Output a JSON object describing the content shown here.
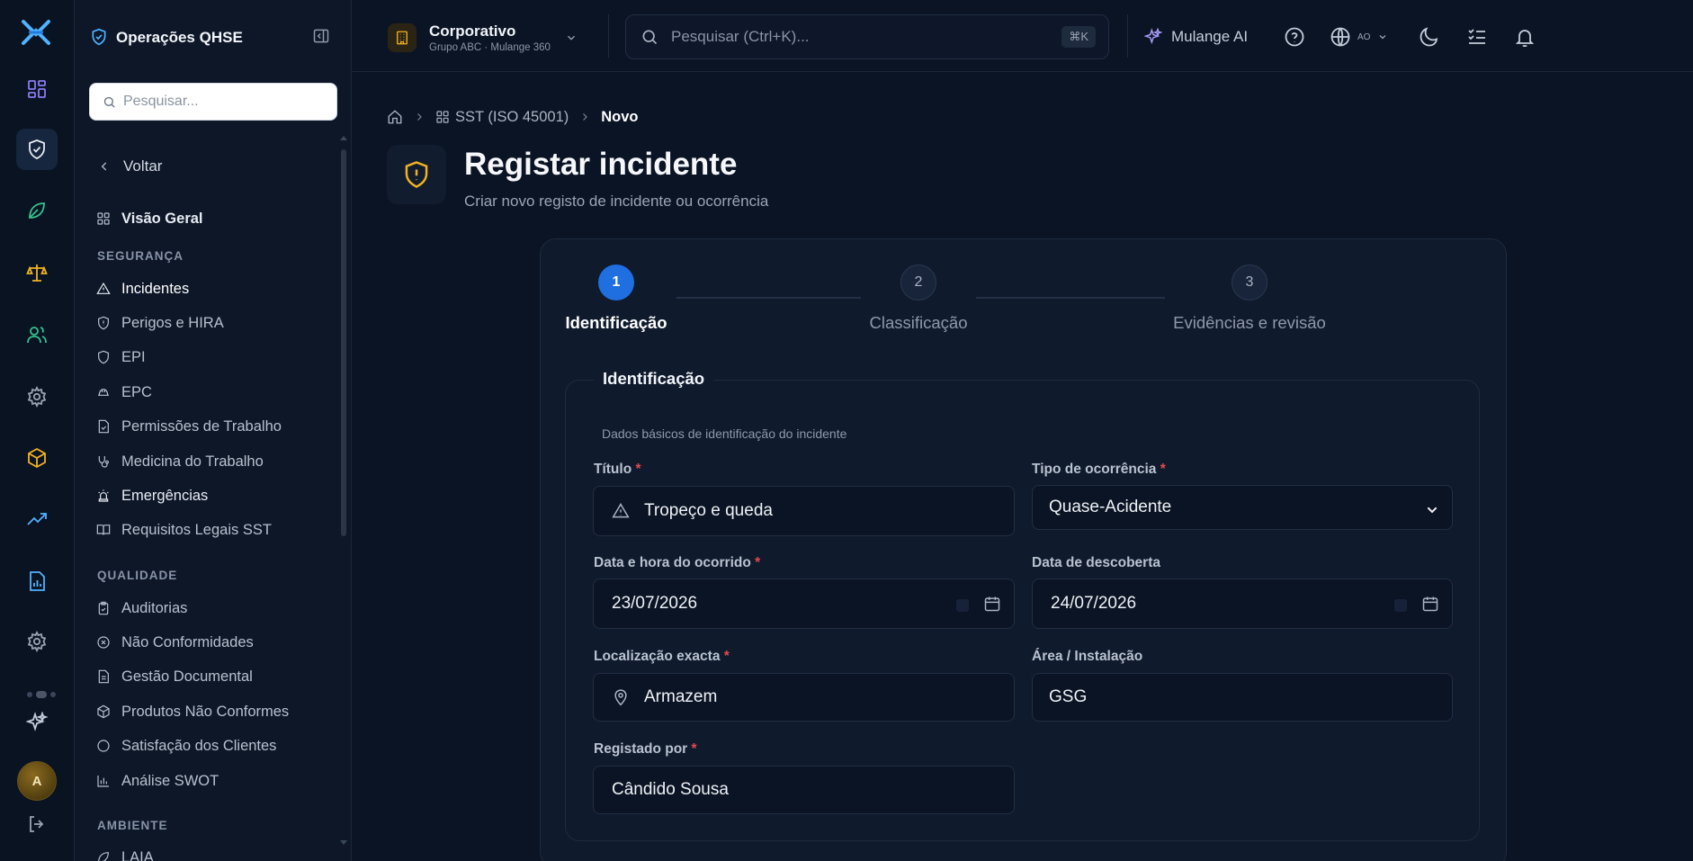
{
  "sidebar": {
    "title": "Operações QHSE",
    "search_placeholder": "Pesquisar...",
    "back": "Voltar",
    "overview": "Visão Geral",
    "sections": {
      "seguranca": "SEGURANÇA",
      "qualidade": "QUALIDADE",
      "ambiente": "AMBIENTE"
    },
    "seguranca_items": [
      {
        "label": "Incidentes",
        "icon": "alert-triangle-icon"
      },
      {
        "label": "Perigos e HIRA",
        "icon": "shield-icon"
      },
      {
        "label": "EPI",
        "icon": "shield-icon"
      },
      {
        "label": "EPC",
        "icon": "helmet-icon"
      },
      {
        "label": "Permissões de Trabalho",
        "icon": "file-check-icon"
      },
      {
        "label": "Medicina do Trabalho",
        "icon": "stethoscope-icon"
      },
      {
        "label": "Emergências",
        "icon": "siren-icon"
      },
      {
        "label": "Requisitos Legais SST",
        "icon": "book-icon"
      }
    ],
    "qualidade_items": [
      {
        "label": "Auditorias",
        "icon": "clipboard-check-icon"
      },
      {
        "label": "Não Conformidades",
        "icon": "x-circle-icon"
      },
      {
        "label": "Gestão Documental",
        "icon": "file-text-icon"
      },
      {
        "label": "Produtos Não Conformes",
        "icon": "package-icon"
      },
      {
        "label": "Satisfação dos Clientes",
        "icon": "circle-icon"
      },
      {
        "label": "Análise SWOT",
        "icon": "bar-chart-icon"
      }
    ],
    "ambiente_items": [
      {
        "label": "LAIA",
        "icon": "leaf-icon"
      }
    ]
  },
  "rail": {
    "avatar_initial": "A"
  },
  "topbar": {
    "org_name": "Corporativo",
    "org_sub": "Grupo ABC · Mulange 360",
    "search_placeholder": "Pesquisar (Ctrl+K)...",
    "search_shortcut": "⌘K",
    "ai_label": "Mulange AI",
    "lang_code": "AO"
  },
  "breadcrumb": {
    "section": "SST (ISO 45001)",
    "current": "Novo"
  },
  "page": {
    "title": "Registar incidente",
    "subtitle": "Criar novo registo de incidente ou ocorrência"
  },
  "steps": [
    {
      "number": "1",
      "label": "Identificação",
      "active": true
    },
    {
      "number": "2",
      "label": "Classificação",
      "active": false
    },
    {
      "number": "3",
      "label": "Evidências e revisão",
      "active": false
    }
  ],
  "form": {
    "legend": "Identificação",
    "description": "Dados básicos de identificação do incidente",
    "titulo": {
      "label": "Título",
      "value": "Tropeço e queda"
    },
    "tipo": {
      "label": "Tipo de ocorrência",
      "value": "Quase-Acidente"
    },
    "data_ocorrido": {
      "label": "Data e hora do ocorrido",
      "value": "23/07/2026"
    },
    "data_descoberta": {
      "label": "Data de descoberta",
      "value": "24/07/2026"
    },
    "localizacao": {
      "label": "Localização exacta",
      "value": "Armazem"
    },
    "area": {
      "label": "Área / Instalação",
      "value": "GSG"
    },
    "registado_por": {
      "label": "Registado por",
      "value": "Cândido Sousa"
    },
    "required_mark": "*"
  },
  "colors": {
    "accent": "#1f6fe0",
    "background": "#0b1424",
    "card": "#0f1a2c",
    "required": "#e5484d",
    "amber": "#f2b320",
    "green": "#34c38f"
  }
}
